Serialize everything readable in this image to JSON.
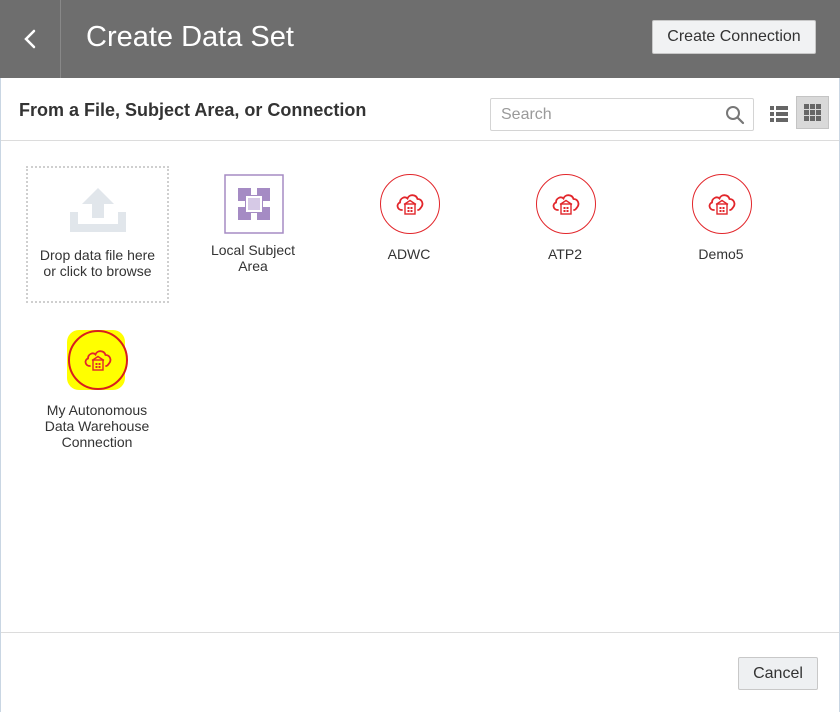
{
  "header": {
    "title": "Create Data Set",
    "back_icon": "chevron-left-icon",
    "create_connection_label": "Create Connection",
    "background": "#6e6e6e"
  },
  "toolbar": {
    "subtitle": "From a File, Subject Area, or Connection",
    "search": {
      "placeholder": "Search",
      "value": ""
    },
    "view_modes": [
      "list-view-icon",
      "grid-view-icon"
    ],
    "selected_view": "grid"
  },
  "dropzone": {
    "line1": "Drop data file here",
    "line2": "or click to browse",
    "icon": "upload-icon"
  },
  "sources": [
    {
      "label_lines": [
        "Local Subject",
        "Area"
      ],
      "icon": "subject-area-icon",
      "color": "#a58bc4"
    },
    {
      "label_lines": [
        "ADWC"
      ],
      "icon": "cloud-database-icon",
      "color": "#e2262b"
    },
    {
      "label_lines": [
        "ATP2"
      ],
      "icon": "cloud-database-icon",
      "color": "#e2262b"
    },
    {
      "label_lines": [
        "Demo5"
      ],
      "icon": "cloud-database-icon",
      "color": "#e2262b"
    },
    {
      "label_lines": [
        "My Autonomous",
        "Data Warehouse",
        "Connection"
      ],
      "icon": "cloud-database-icon",
      "color": "#e2262b",
      "highlighted": true,
      "highlight_color": "#ffff00"
    }
  ],
  "footer": {
    "cancel_label": "Cancel"
  }
}
